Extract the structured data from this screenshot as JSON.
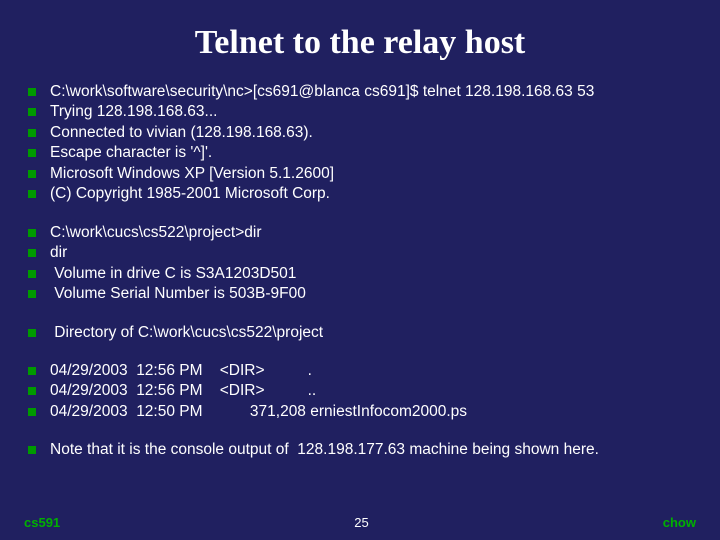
{
  "title": "Telnet to the relay host",
  "blocks": [
    [
      "C:\\work\\software\\security\\nc>[cs691@blanca cs691]$ telnet 128.198.168.63 53",
      "Trying 128.198.168.63...",
      "Connected to vivian (128.198.168.63).",
      "Escape character is '^]'.",
      "Microsoft Windows XP [Version 5.1.2600]",
      "(C) Copyright 1985-2001 Microsoft Corp."
    ],
    [
      "C:\\work\\cucs\\cs522\\project>dir",
      "dir",
      " Volume in drive C is S3A1203D501",
      " Volume Serial Number is 503B-9F00"
    ],
    [
      " Directory of C:\\work\\cucs\\cs522\\project"
    ],
    [
      "04/29/2003  12:56 PM    <DIR>          .",
      "04/29/2003  12:56 PM    <DIR>          ..",
      "04/29/2003  12:50 PM           371,208 erniestInfocom2000.ps"
    ],
    [
      "Note that it is the console output of  128.198.177.63 machine being shown here."
    ]
  ],
  "footer": {
    "left": "cs591",
    "center": "25",
    "right": "chow"
  }
}
